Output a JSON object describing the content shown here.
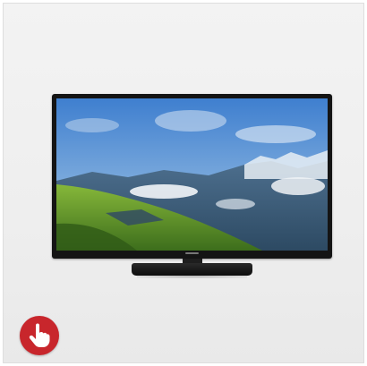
{
  "product_card": {
    "image_subject": "tv-icon",
    "badge_icon": "hand-pointer-icon",
    "colors": {
      "background": "#efefef",
      "badge": "#c8262c",
      "badge_icon": "#ffffff",
      "tv_frame": "#141414"
    }
  }
}
